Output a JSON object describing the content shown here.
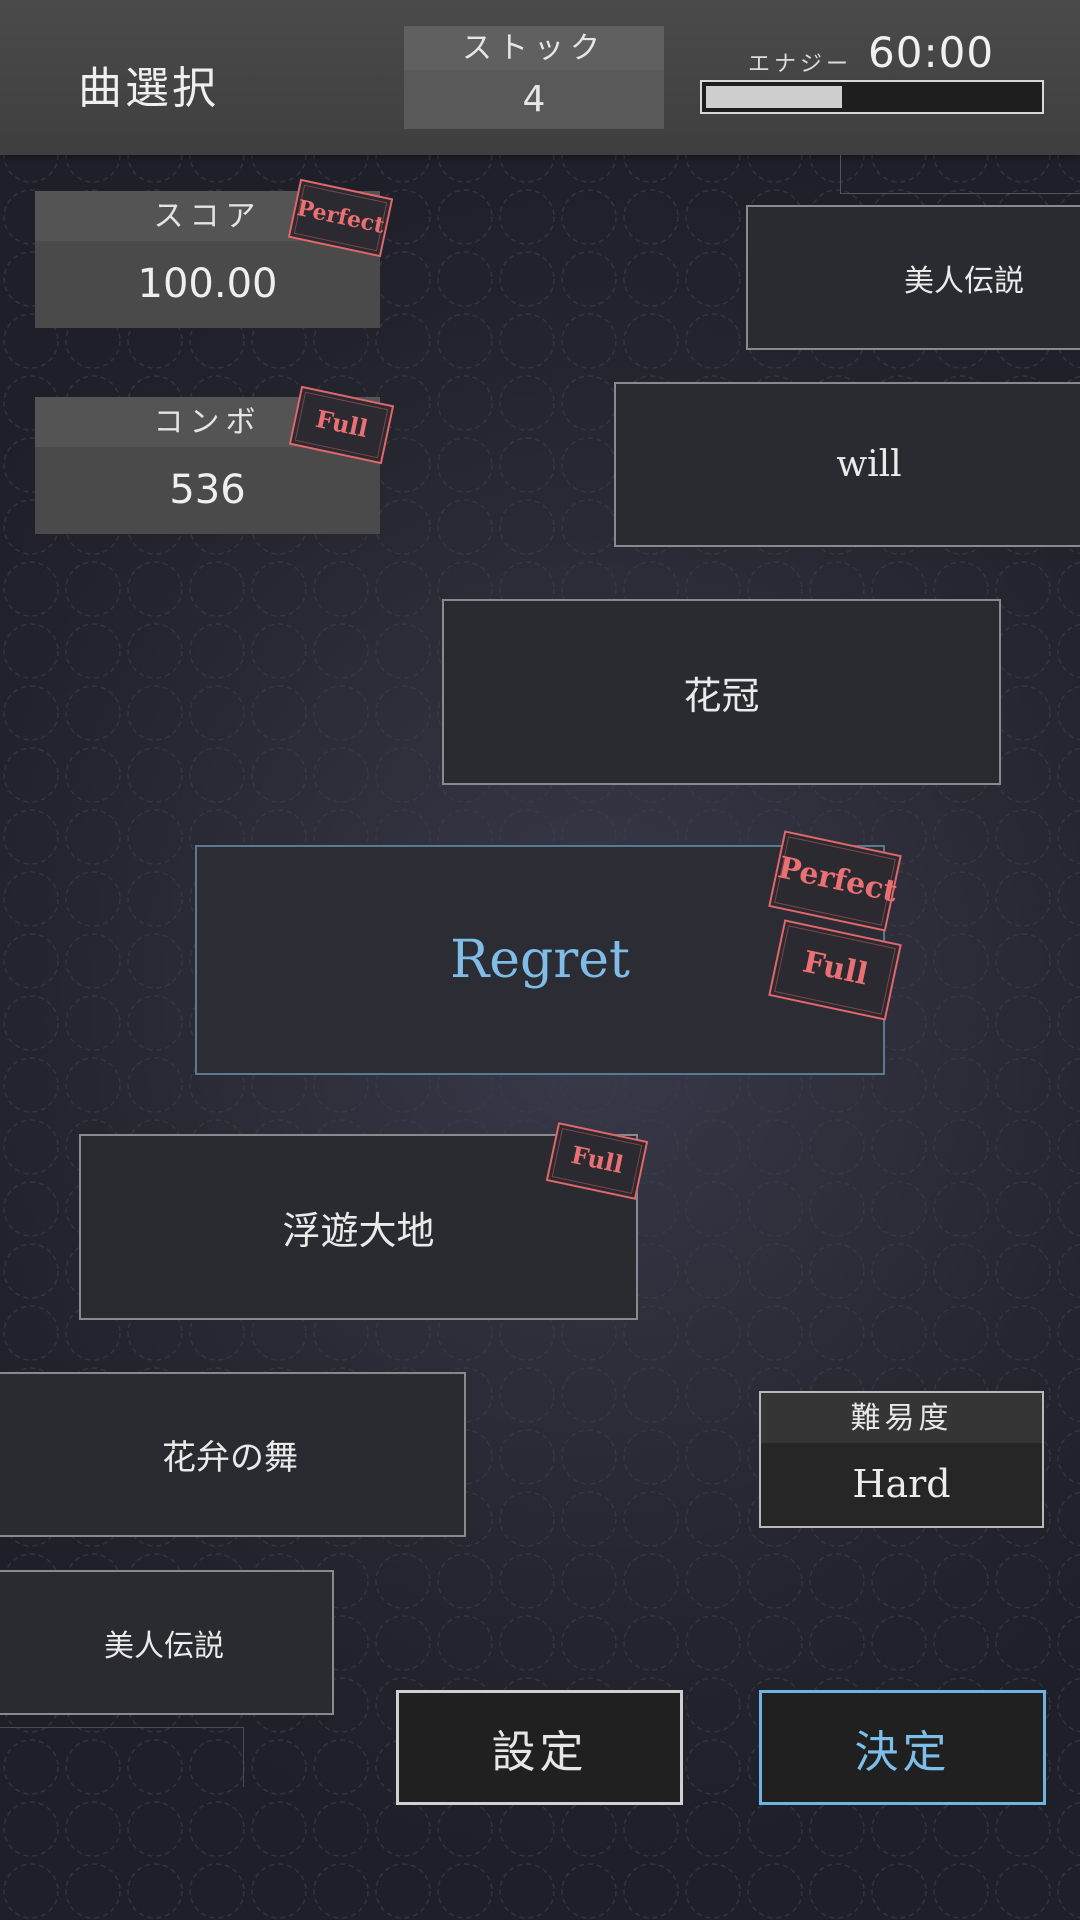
{
  "header": {
    "title": "曲選択",
    "stock": {
      "label": "ストック",
      "value": "4"
    },
    "energy": {
      "label": "エナジー",
      "time": "60:00",
      "fill_fraction": 0.41
    }
  },
  "stats": {
    "score": {
      "label": "スコア",
      "value": "100.00",
      "badge": "Perfect"
    },
    "combo": {
      "label": "コンボ",
      "value": "536",
      "badge": "Full"
    }
  },
  "songs": [
    {
      "title": "美人伝説"
    },
    {
      "title": "will"
    },
    {
      "title": "花冠"
    },
    {
      "title": "Regret",
      "badges": [
        "Perfect",
        "Full"
      ],
      "selected": true
    },
    {
      "title": "浮遊大地",
      "badges": [
        "Full"
      ]
    },
    {
      "title": "花弁の舞"
    },
    {
      "title": "美人伝説"
    }
  ],
  "difficulty": {
    "label": "難易度",
    "value": "Hard"
  },
  "buttons": {
    "settings": "設定",
    "decide": "決定"
  },
  "colors": {
    "accent_blue": "#7cc0ea",
    "badge_red": "#e0676a",
    "header_bg": "#4a4a4a",
    "background": "#2c2d38"
  }
}
